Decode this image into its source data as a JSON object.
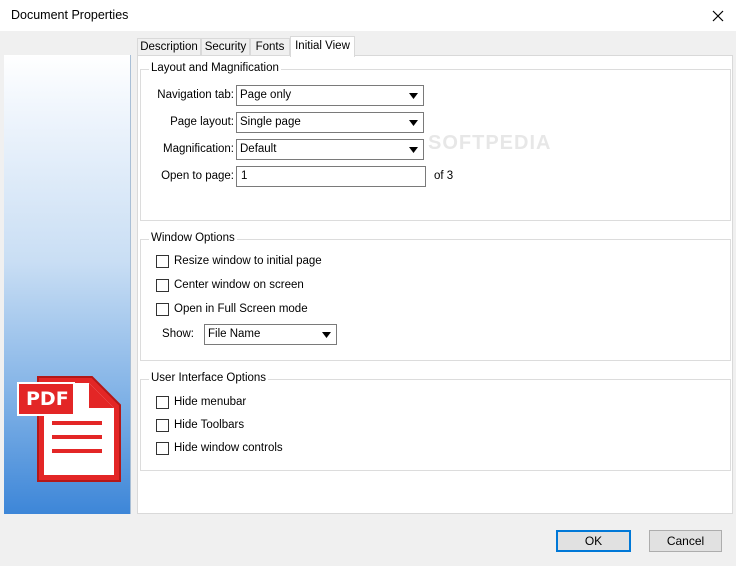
{
  "window": {
    "title": "Document Properties"
  },
  "tabs": [
    {
      "label": "Description",
      "active": false
    },
    {
      "label": "Security",
      "active": false
    },
    {
      "label": "Fonts",
      "active": false
    },
    {
      "label": "Initial View",
      "active": true
    }
  ],
  "layout_group": {
    "title": "Layout and Magnification",
    "navigation_tab_label": "Navigation tab:",
    "navigation_tab_value": "Page only",
    "page_layout_label": "Page layout:",
    "page_layout_value": "Single page",
    "magnification_label": "Magnification:",
    "magnification_value": "Default",
    "open_to_page_label": "Open to page:",
    "open_to_page_value": "1",
    "page_count_text": "of 3"
  },
  "window_group": {
    "title": "Window Options",
    "resize_label": "Resize window to initial page",
    "resize_checked": false,
    "center_label": "Center window on screen",
    "center_checked": false,
    "fullscreen_label": "Open in Full Screen mode",
    "fullscreen_checked": false,
    "show_label": "Show:",
    "show_value": "File Name"
  },
  "ui_group": {
    "title": "User Interface Options",
    "hide_menubar_label": "Hide menubar",
    "hide_menubar_checked": false,
    "hide_toolbars_label": "Hide Toolbars",
    "hide_toolbars_checked": false,
    "hide_window_controls_label": "Hide window controls",
    "hide_window_controls_checked": false
  },
  "sidebar": {
    "icon": "pdf-file-icon",
    "icon_text": "PDF"
  },
  "buttons": {
    "ok_label": "OK",
    "cancel_label": "Cancel"
  },
  "watermark": "SOFTPEDIA",
  "colors": {
    "accent": "#0078d7",
    "pdf_red": "#e32626",
    "panel_blue": "#3d86d8"
  }
}
